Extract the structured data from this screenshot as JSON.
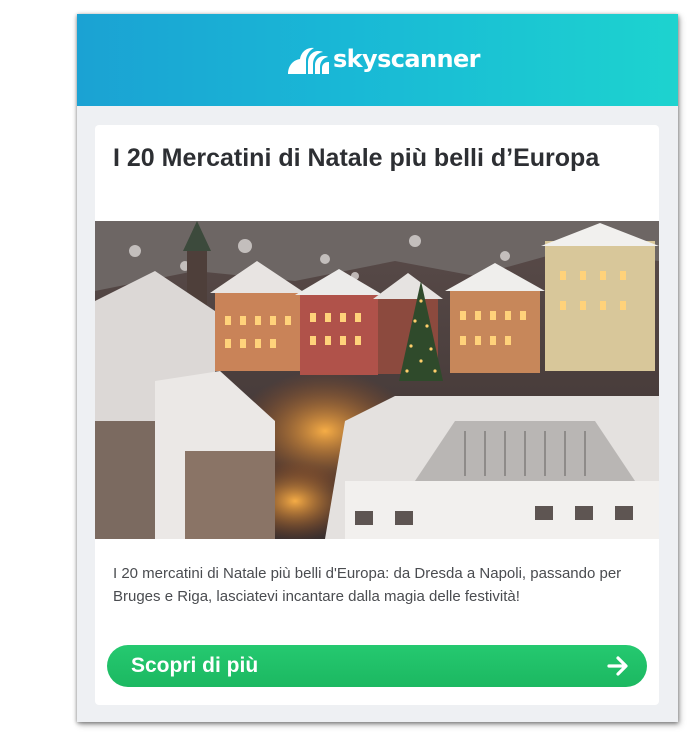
{
  "header": {
    "logo_text": "skyscanner",
    "logo_icon": "skyscanner-sunrise-icon",
    "gradient_colors": [
      "#1ba2d3",
      "#1dd3cf"
    ]
  },
  "article": {
    "title": "I 20 Mercatini di Natale più belli d’Europa",
    "image": "christmas-market-town-snow-image",
    "description": "I 20 mercatini di Natale più belli d'Europa: da Dresda a Napoli, passando per Bruges e Riga, lasciatevi incantare dalla magia delle festività!",
    "cta_label": "Scopri di più",
    "cta_icon": "arrow-right-icon",
    "cta_color": "#1fc068"
  }
}
